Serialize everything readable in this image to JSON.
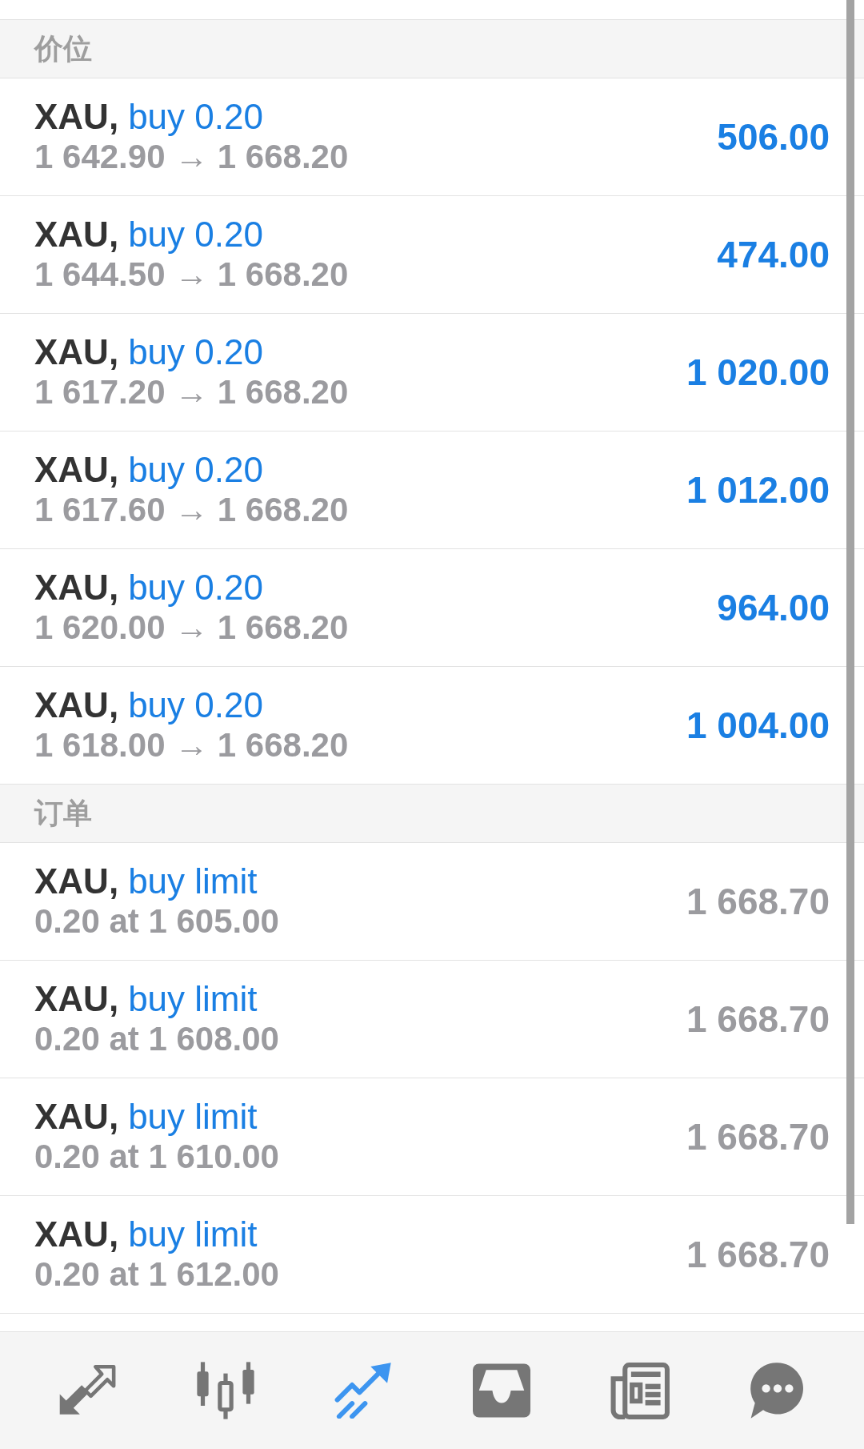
{
  "sections": [
    {
      "title": "价位",
      "kind": "positions",
      "rows": [
        {
          "symbol": "XAU,",
          "type": "buy 0.20",
          "prices": "1 642.90 → 1 668.20",
          "value": "506.00"
        },
        {
          "symbol": "XAU,",
          "type": "buy 0.20",
          "prices": "1 644.50 → 1 668.20",
          "value": "474.00"
        },
        {
          "symbol": "XAU,",
          "type": "buy 0.20",
          "prices": "1 617.20 → 1 668.20",
          "value": "1 020.00"
        },
        {
          "symbol": "XAU,",
          "type": "buy 0.20",
          "prices": "1 617.60 → 1 668.20",
          "value": "1 012.00"
        },
        {
          "symbol": "XAU,",
          "type": "buy 0.20",
          "prices": "1 620.00 → 1 668.20",
          "value": "964.00"
        },
        {
          "symbol": "XAU,",
          "type": "buy 0.20",
          "prices": "1 618.00 → 1 668.20",
          "value": "1 004.00"
        }
      ]
    },
    {
      "title": "订单",
      "kind": "orders",
      "rows": [
        {
          "symbol": "XAU,",
          "type": "buy limit",
          "prices": "0.20 at 1 605.00",
          "value": "1 668.70"
        },
        {
          "symbol": "XAU,",
          "type": "buy limit",
          "prices": "0.20 at 1 608.00",
          "value": "1 668.70"
        },
        {
          "symbol": "XAU,",
          "type": "buy limit",
          "prices": "0.20 at 1 610.00",
          "value": "1 668.70"
        },
        {
          "symbol": "XAU,",
          "type": "buy limit",
          "prices": "0.20 at 1 612.00",
          "value": "1 668.70"
        }
      ]
    }
  ],
  "nav": [
    {
      "kind": "quotes",
      "selected": false
    },
    {
      "kind": "chart",
      "selected": false
    },
    {
      "kind": "trade",
      "selected": true
    },
    {
      "kind": "mailbox",
      "selected": false
    },
    {
      "kind": "news",
      "selected": false
    },
    {
      "kind": "chat",
      "selected": false
    }
  ]
}
